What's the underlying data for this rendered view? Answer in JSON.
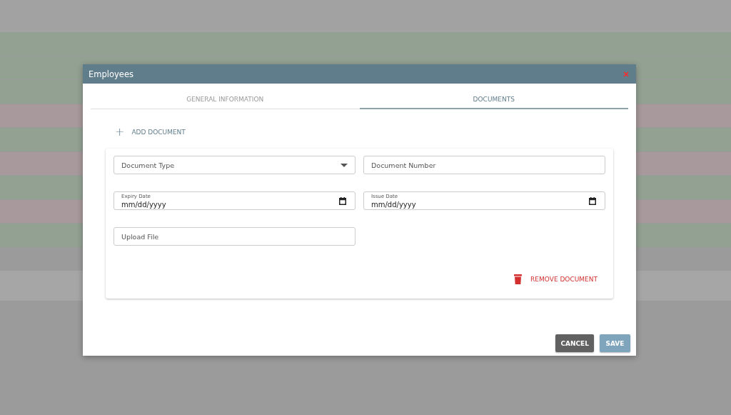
{
  "backdrop": {
    "rows": [
      {
        "color": "#93a193"
      },
      {
        "color": "#93a193"
      },
      {
        "color": "#93a193"
      },
      {
        "color": "#a89a9c"
      },
      {
        "color": "#93a193"
      },
      {
        "color": "#a89a9c"
      },
      {
        "color": "#93a193"
      },
      {
        "color": "#a89a9c"
      },
      {
        "color": "#93a193"
      }
    ]
  },
  "dialog": {
    "title": "Employees",
    "tabs": [
      {
        "label": "GENERAL INFORMATION",
        "selected": false
      },
      {
        "label": "DOCUMENTS",
        "selected": true
      }
    ],
    "add_button": {
      "icon": "+",
      "label": "ADD DOCUMENT"
    },
    "document": {
      "fields": [
        {
          "kind": "select",
          "placeholder": "Document Type"
        },
        {
          "kind": "text",
          "placeholder": "Document Number"
        },
        {
          "kind": "date",
          "label": "Expiry Date",
          "placeholder": "mm/dd/yyyy"
        },
        {
          "kind": "date",
          "label": "Issue Date",
          "placeholder": "mm/dd/yyyy"
        },
        {
          "kind": "text",
          "placeholder": "Upload File"
        }
      ],
      "remove_button": "REMOVE DOCUMENT"
    },
    "buttons": [
      {
        "label": "CANCEL",
        "kind": "secondary"
      },
      {
        "label": "SAVE",
        "kind": "primary"
      }
    ]
  }
}
